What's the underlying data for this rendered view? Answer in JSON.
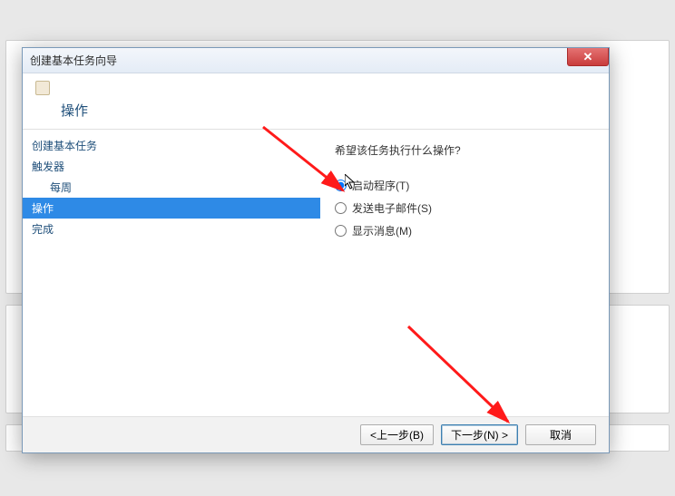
{
  "window": {
    "title": "创建基本任务向导",
    "close_glyph": "✕"
  },
  "header": {
    "title": "操作"
  },
  "sidebar": {
    "items": [
      {
        "label": "创建基本任务",
        "selected": false,
        "sub": false
      },
      {
        "label": "触发器",
        "selected": false,
        "sub": false
      },
      {
        "label": "每周",
        "selected": false,
        "sub": true
      },
      {
        "label": "操作",
        "selected": true,
        "sub": false
      },
      {
        "label": "完成",
        "selected": false,
        "sub": false
      }
    ]
  },
  "content": {
    "prompt": "希望该任务执行什么操作?",
    "options": [
      {
        "label": "启动程序(T)",
        "checked": true
      },
      {
        "label": "发送电子邮件(S)",
        "checked": false
      },
      {
        "label": "显示消息(M)",
        "checked": false
      }
    ]
  },
  "footer": {
    "back": "<上一步(B)",
    "next": "下一步(N) >",
    "cancel": "取消"
  }
}
